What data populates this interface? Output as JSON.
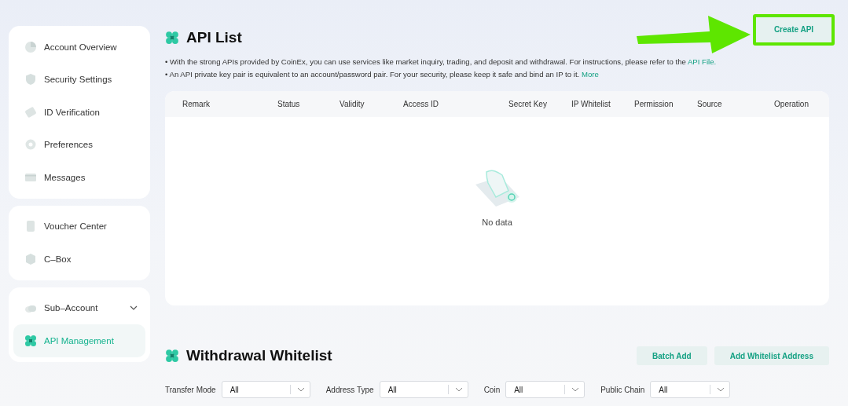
{
  "sidebar": {
    "groups": [
      {
        "items": [
          {
            "label": "Account Overview",
            "selected": false
          },
          {
            "label": "Security Settings",
            "selected": false
          },
          {
            "label": "ID Verification",
            "selected": false
          },
          {
            "label": "Preferences",
            "selected": false
          },
          {
            "label": "Messages",
            "selected": false
          }
        ]
      },
      {
        "items": [
          {
            "label": "Voucher Center",
            "selected": false
          },
          {
            "label": "C–Box",
            "selected": false
          }
        ]
      },
      {
        "items": [
          {
            "label": "Sub–Account",
            "selected": false,
            "expanded": true
          },
          {
            "label": "API Management",
            "selected": true
          }
        ]
      }
    ]
  },
  "api_list": {
    "title": "API List",
    "create_button": {
      "label": "Create API",
      "highlighted": true
    },
    "notes": [
      {
        "text": "• With the strong APIs provided by CoinEx, you can use services like market inquiry, trading, and deposit and withdrawal. For instructions, please refer to the",
        "link": "API File."
      },
      {
        "text": "• An API private key pair is equivalent to an account/password pair. For your security, please keep it safe and bind an IP to it.",
        "link": "More"
      }
    ],
    "table": {
      "columns": [
        "Remark",
        "Status",
        "Validity",
        "Access ID",
        "Secret Key",
        "IP Whitelist",
        "Permission",
        "Source",
        "Operation"
      ],
      "empty_text": "No data"
    }
  },
  "withdrawal_whitelist": {
    "title": "Withdrawal Whitelist",
    "buttons": [
      "Batch Add",
      "Add Whitelist Address"
    ],
    "filters": [
      {
        "label": "Transfer Mode",
        "value": "All"
      },
      {
        "label": "Address Type",
        "value": "All"
      },
      {
        "label": "Coin",
        "value": "All"
      },
      {
        "label": "Public Chain",
        "value": "All"
      }
    ]
  }
}
